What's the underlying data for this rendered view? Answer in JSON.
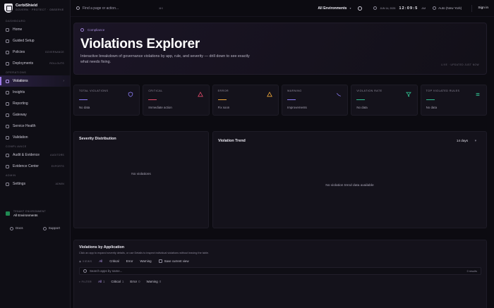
{
  "brand": {
    "name": "CerbiShield",
    "subtitle": "GOVERN · PROTECT · OBSERVE"
  },
  "sidebar": {
    "sections": [
      {
        "label": "DASHBOARD",
        "items": [
          {
            "label": "Home",
            "badge": ""
          },
          {
            "label": "Guided Setup",
            "badge": ""
          },
          {
            "label": "Policies",
            "badge": "GOVERNANCE"
          },
          {
            "label": "Deployments",
            "badge": "ROLLOUTS"
          }
        ]
      },
      {
        "label": "OPERATIONS",
        "items": [
          {
            "label": "Violations",
            "badge": ""
          },
          {
            "label": "Insights",
            "badge": ""
          },
          {
            "label": "Reporting",
            "badge": ""
          },
          {
            "label": "Gateway",
            "badge": ""
          },
          {
            "label": "Service Health",
            "badge": ""
          },
          {
            "label": "Validation",
            "badge": ""
          }
        ]
      },
      {
        "label": "COMPLIANCE",
        "items": [
          {
            "label": "Audit & Evidence",
            "badge": "AUDITORS"
          },
          {
            "label": "Evidence Center",
            "badge": "EXPORTS"
          }
        ]
      },
      {
        "label": "ADMIN",
        "items": [
          {
            "label": "Settings",
            "badge": "ADMIN"
          }
        ]
      }
    ],
    "tenant": {
      "label": "TENANT ENVIRONMENT",
      "value": "All Environments"
    },
    "footer": {
      "docs": "Docs",
      "support": "Support"
    }
  },
  "topbar": {
    "search_placeholder": "Find a page or action...",
    "shortcut": "⌘K",
    "environment": "All Environments",
    "date": "JUN 14, 2025",
    "time": "12:09:5",
    "ampm": "AM",
    "timezone": "Auto (New York)",
    "signin": "Sign in"
  },
  "hero": {
    "crumb": "Compliance",
    "title": "Violations Explorer",
    "description": "Interactive breakdown of governance violations by app, rule, and severity — drill down to see exactly what needs fixing.",
    "meta": "LIVE · UPDATED JUST NOW"
  },
  "stats": [
    {
      "label": "TOTAL VIOLATIONS",
      "sub": "No data",
      "color": "#8b7cf6",
      "icon": "shield-icon"
    },
    {
      "label": "CRITICAL",
      "sub": "Immediate action",
      "color": "#e14a6a",
      "icon": "alert-triangle-icon"
    },
    {
      "label": "ERROR",
      "sub": "Fix soon",
      "color": "#f0a93a",
      "icon": "warning-triangle-icon"
    },
    {
      "label": "WARNING",
      "sub": "Improvements",
      "color": "#8b7cf6",
      "icon": "trend-icon"
    },
    {
      "label": "VIOLATION RATE",
      "sub": "No data",
      "color": "#2fbf8f",
      "icon": "filter-icon"
    },
    {
      "label": "TOP VIOLATED RULES",
      "sub": "No data",
      "color": "#2fbf8f",
      "icon": "list-icon"
    }
  ],
  "severity": {
    "title": "Severity Distribution",
    "empty": "No violations"
  },
  "trend": {
    "title": "Violation Trend",
    "range": "14 days",
    "empty": "No violation trend data available"
  },
  "apps": {
    "title": "Violations by Application",
    "subtitle": "Click an app to expand severity details, or use Details to inspect individual violations without leaving the table.",
    "views_label": "VIEWS",
    "views": [
      "All",
      "Critical",
      "Error",
      "Warning"
    ],
    "save_view": "Save current view",
    "search_placeholder": "Search apps by name...",
    "results": "0 results",
    "filter_label": "FILTER",
    "filters": [
      {
        "label": "All",
        "count": "1"
      },
      {
        "label": "Critical",
        "count": "1"
      },
      {
        "label": "Error",
        "count": "0"
      },
      {
        "label": "Warning",
        "count": "0"
      }
    ]
  }
}
